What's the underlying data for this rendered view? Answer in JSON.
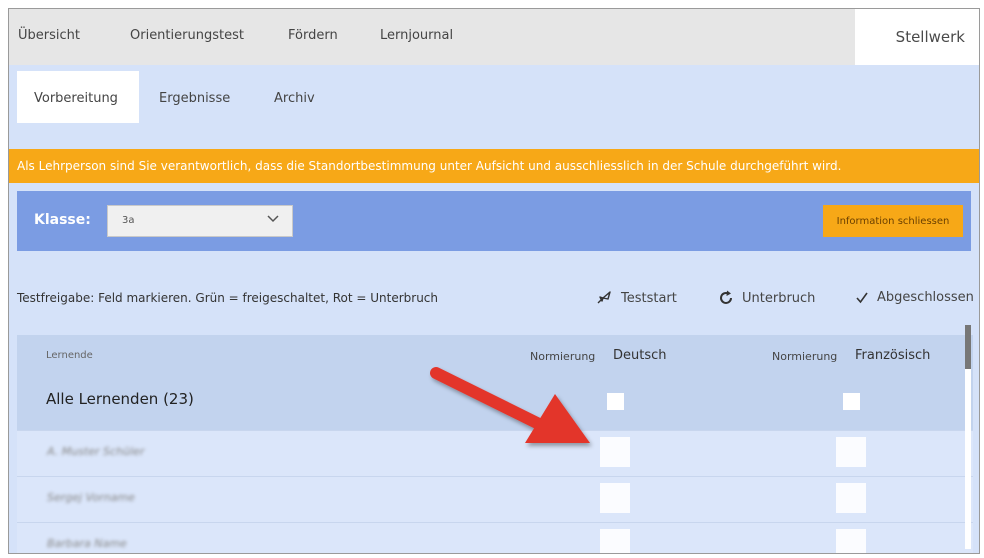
{
  "topnav": {
    "items": [
      "Übersicht",
      "Orientierungstest",
      "Fördern",
      "Lernjournal"
    ],
    "brand": "Stellwerk"
  },
  "tabs": [
    "Vorbereitung",
    "Ergebnisse",
    "Archiv"
  ],
  "warning": "Als Lehrperson sind Sie verantwortlich, dass die Standortbestimmung unter Aufsicht und ausschliesslich in der Schule durchgeführt wird.",
  "class_bar": {
    "label": "Klasse:",
    "selected": "3a",
    "info_button": "Information schliessen"
  },
  "legend": {
    "text": "Testfreigabe: Feld markieren. Grün = freigeschaltet, Rot = Unterbruch",
    "teststart": "Teststart",
    "unterbruch": "Unterbruch",
    "abgeschlossen": "Abgeschlossen"
  },
  "table": {
    "col_learners": "Lernende",
    "normierung": "Normierung",
    "subject_1": "Deutsch",
    "subject_2": "Französisch",
    "all_row": "Alle Lernenden (23)",
    "rows": [
      "A. Muster Schüler",
      "Sergej Vorname",
      "Barbara Name"
    ]
  },
  "colors": {
    "warning": "#f7a817",
    "class_bar": "#7b9ce3",
    "panel_bg": "#d5e2f9",
    "arrow": "#e3342a"
  }
}
